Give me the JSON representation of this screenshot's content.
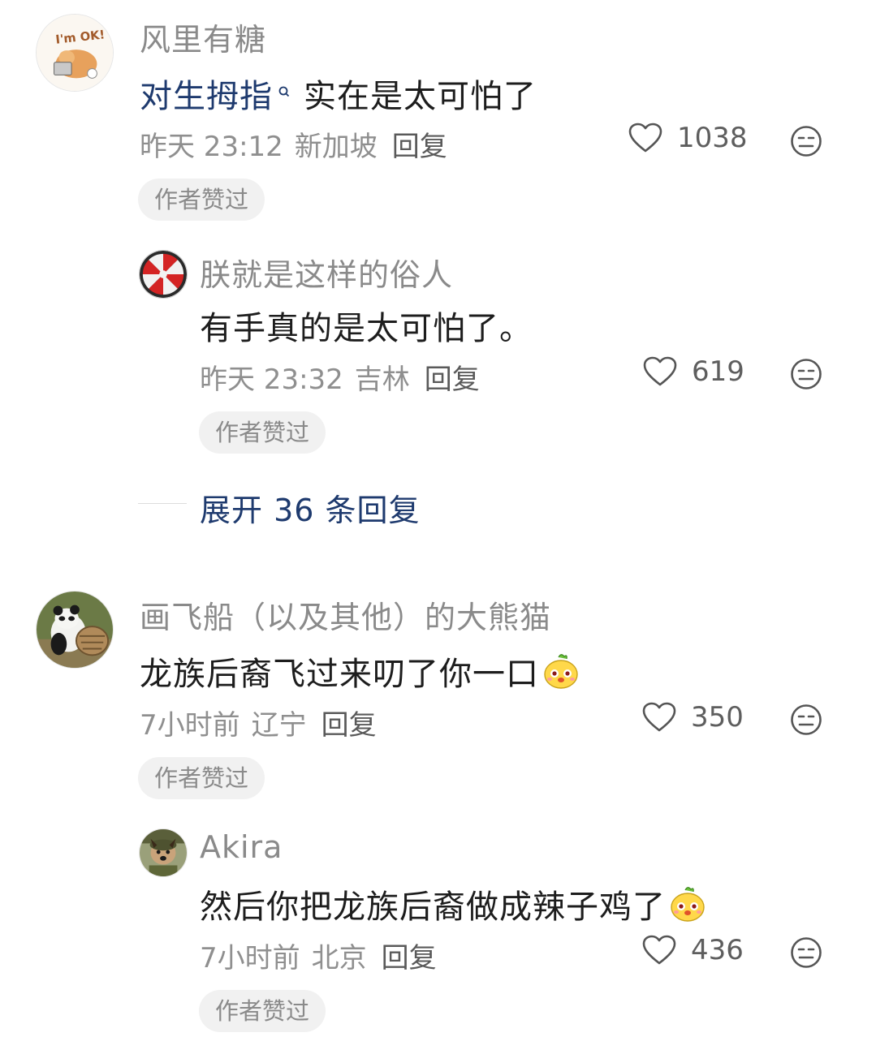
{
  "comments": [
    {
      "user": "风里有糖",
      "avatar_text": "I'm OK!",
      "text_mention": "对生拇指",
      "text_rest": "实在是太可怕了",
      "time": "昨天 23:12",
      "location": "新加坡",
      "reply_label": "回复",
      "likes": "1038",
      "badge": "作者赞过",
      "replies": [
        {
          "user": "朕就是这样的俗人",
          "text": "有手真的是太可怕了。",
          "time": "昨天 23:32",
          "location": "吉林",
          "reply_label": "回复",
          "likes": "619",
          "badge": "作者赞过"
        }
      ],
      "expand_label": "展开 36 条回复"
    },
    {
      "user": "画飞船（以及其他）的大熊猫",
      "text": "龙族后裔飞过来叨了你一口",
      "time": "7小时前",
      "location": "辽宁",
      "reply_label": "回复",
      "likes": "350",
      "badge": "作者赞过",
      "replies": [
        {
          "user": "Akira",
          "text": "然后你把龙族后裔做成辣子鸡了",
          "time": "7小时前",
          "location": "北京",
          "reply_label": "回复",
          "likes": "436",
          "badge": "作者赞过"
        }
      ]
    }
  ],
  "colors": {
    "mention": "#1e3a6e",
    "meta": "#8f8f8f",
    "badge_bg": "#f1f1f1"
  },
  "icons": [
    "heart-outline-icon",
    "meh-face-icon",
    "search-mini-icon",
    "cute-bun-emoji"
  ]
}
